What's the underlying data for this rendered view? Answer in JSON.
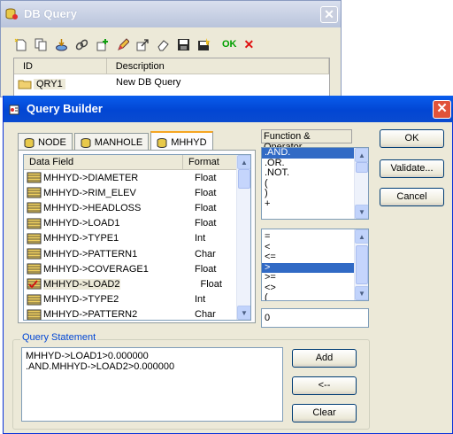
{
  "back_window": {
    "title": "DB Query",
    "close_glyph": "✕",
    "toolbar": {
      "icons": [
        "new-icon",
        "copy-icon",
        "import-icon",
        "link-icon",
        "add-icon",
        "edit-icon",
        "export-icon",
        "erase-icon",
        "save-icon",
        "save-all-icon"
      ],
      "ok_label": "OK",
      "cancel_glyph": "✕"
    },
    "list": {
      "columns": [
        "ID",
        "Description"
      ],
      "rows": [
        {
          "id": "QRY1",
          "description": "New DB Query"
        }
      ]
    }
  },
  "query_builder": {
    "title": "Query Builder",
    "close_glyph": "✕",
    "tabs": [
      {
        "label": "NODE",
        "active": false
      },
      {
        "label": "MANHOLE",
        "active": false
      },
      {
        "label": "MHHYD",
        "active": true
      }
    ],
    "fields_table": {
      "columns": [
        "Data Field",
        "Format"
      ],
      "rows": [
        {
          "field": "MHHYD->DIAMETER",
          "format": "Float",
          "checked": false
        },
        {
          "field": "MHHYD->RIM_ELEV",
          "format": "Float",
          "checked": false
        },
        {
          "field": "MHHYD->HEADLOSS",
          "format": "Float",
          "checked": false
        },
        {
          "field": "MHHYD->LOAD1",
          "format": "Float",
          "checked": false
        },
        {
          "field": "MHHYD->TYPE1",
          "format": "Int",
          "checked": false
        },
        {
          "field": "MHHYD->PATTERN1",
          "format": "Char",
          "checked": false
        },
        {
          "field": "MHHYD->COVERAGE1",
          "format": "Float",
          "checked": false
        },
        {
          "field": "MHHYD->LOAD2",
          "format": "Float",
          "checked": true
        },
        {
          "field": "MHHYD->TYPE2",
          "format": "Int",
          "checked": false
        },
        {
          "field": "MHHYD->PATTERN2",
          "format": "Char",
          "checked": false
        }
      ]
    },
    "function_operator": {
      "label": "Function & Operator",
      "items": [
        ".AND.",
        ".OR.",
        ".NOT.",
        "(",
        ")",
        "+"
      ],
      "selected": ".AND."
    },
    "comparison": {
      "items": [
        "=",
        "<",
        "<=",
        ">",
        ">=",
        "<>",
        "("
      ],
      "selected": ">"
    },
    "value": "0",
    "query_statement": {
      "label": "Query Statement",
      "text": "MHHYD->LOAD1>0.000000\n.AND.MHHYD->LOAD2>0.000000"
    },
    "buttons": {
      "ok": "OK",
      "validate": "Validate...",
      "cancel": "Cancel",
      "add": "Add",
      "back": "<--",
      "clear": "Clear"
    },
    "colors": {
      "title_bar": "#0a4fe0",
      "selection": "#316ac5",
      "group_label": "#0046d5",
      "active_tab": "#f5a623"
    }
  }
}
